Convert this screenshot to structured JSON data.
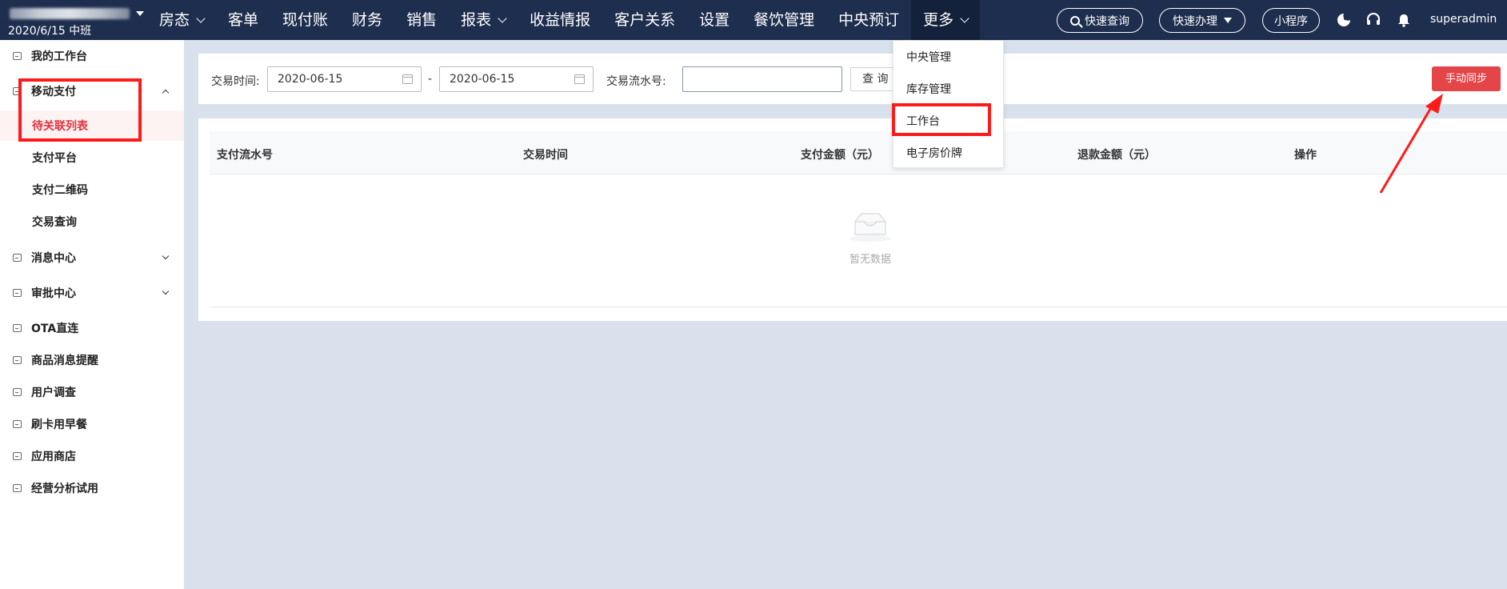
{
  "header": {
    "shift_date": "2020/6/15 中班",
    "nav": [
      {
        "label": "房态",
        "dropdown": true
      },
      {
        "label": "客单",
        "dropdown": false
      },
      {
        "label": "现付账",
        "dropdown": false
      },
      {
        "label": "财务",
        "dropdown": false
      },
      {
        "label": "销售",
        "dropdown": false
      },
      {
        "label": "报表",
        "dropdown": true
      },
      {
        "label": "收益情报",
        "dropdown": false
      },
      {
        "label": "客户关系",
        "dropdown": false
      },
      {
        "label": "设置",
        "dropdown": false
      },
      {
        "label": "餐饮管理",
        "dropdown": false
      },
      {
        "label": "中央预订",
        "dropdown": false
      },
      {
        "label": "更多",
        "dropdown": true,
        "active": true
      }
    ],
    "quick_search": "快速查询",
    "quick_handle": "快速办理",
    "mini_program": "小程序",
    "username": "superadmin",
    "icons": [
      "moon-icon",
      "headset-icon",
      "bell-icon"
    ]
  },
  "more_menu": {
    "items": [
      "中央管理",
      "库存管理",
      "工作台",
      "电子房价牌"
    ]
  },
  "sidebar": {
    "items": [
      {
        "label": "我的工作台"
      },
      {
        "label": "移动支付",
        "expanded": true,
        "children": [
          "待关联列表",
          "支付平台",
          "支付二维码",
          "交易查询"
        ]
      },
      {
        "label": "消息中心",
        "collapsible": true
      },
      {
        "label": "审批中心",
        "collapsible": true
      },
      {
        "label": "OTA直连"
      },
      {
        "label": "商品消息提醒"
      },
      {
        "label": "用户调查"
      },
      {
        "label": "刷卡用早餐"
      },
      {
        "label": "应用商店"
      },
      {
        "label": "经营分析试用"
      }
    ]
  },
  "filter": {
    "time_label": "交易时间:",
    "start_date": "2020-06-15",
    "separator": "-",
    "end_date": "2020-06-15",
    "serial_label": "交易流水号:",
    "serial_value": "",
    "query_button": "查 询",
    "sync_button": "手动同步"
  },
  "table": {
    "columns": [
      "支付流水号",
      "交易时间",
      "支付金额（元）",
      "退款金额（元）",
      "操作"
    ],
    "rows": [],
    "empty_text": "暂无数据"
  },
  "colors": {
    "topbar": "#1e2e4e",
    "accent_red": "#e34549",
    "annotation_red": "#ff1a1a"
  }
}
